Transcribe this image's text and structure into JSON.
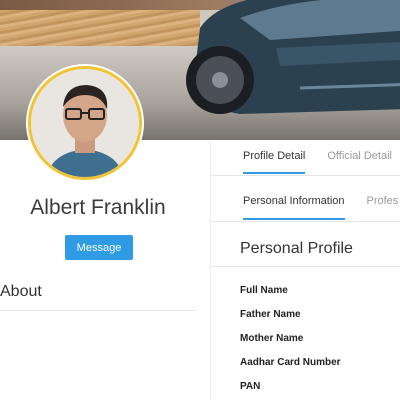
{
  "profile": {
    "name": "Albert Franklin",
    "message_label": "Message",
    "about_label": "About"
  },
  "tabs": [
    {
      "label": "Profile Detail",
      "active": true
    },
    {
      "label": "Official Detail",
      "active": false
    }
  ],
  "subtabs": [
    {
      "label": "Personal Information",
      "active": true
    },
    {
      "label": "Profes",
      "active": false
    }
  ],
  "section": {
    "title": "Personal Profile",
    "fields": [
      "Full Name",
      "Father Name",
      "Mother Name",
      "Aadhar Card Number",
      "PAN"
    ]
  },
  "colors": {
    "accent": "#2f9be4",
    "avatar_ring": "#f2c433"
  }
}
